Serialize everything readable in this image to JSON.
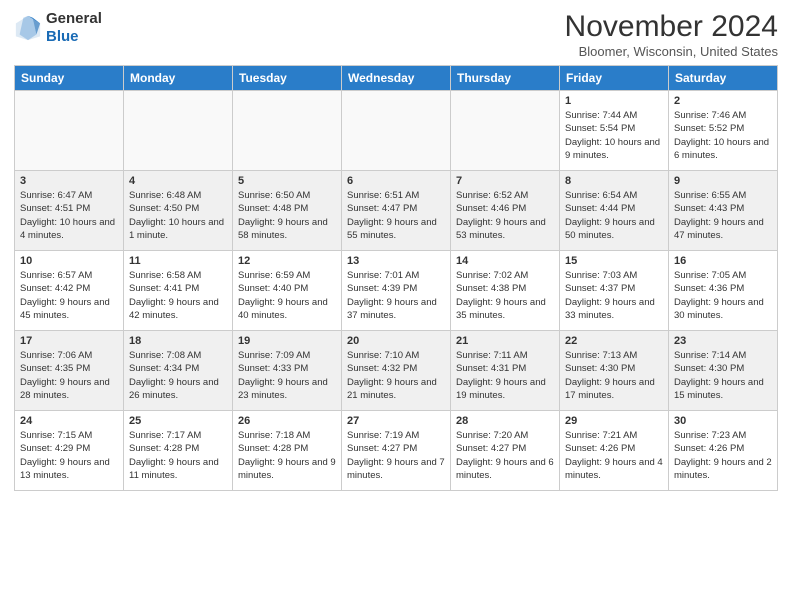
{
  "header": {
    "logo_line1": "General",
    "logo_line2": "Blue",
    "month": "November 2024",
    "location": "Bloomer, Wisconsin, United States"
  },
  "days_of_week": [
    "Sunday",
    "Monday",
    "Tuesday",
    "Wednesday",
    "Thursday",
    "Friday",
    "Saturday"
  ],
  "weeks": [
    [
      {
        "day": "",
        "info": ""
      },
      {
        "day": "",
        "info": ""
      },
      {
        "day": "",
        "info": ""
      },
      {
        "day": "",
        "info": ""
      },
      {
        "day": "",
        "info": ""
      },
      {
        "day": "1",
        "info": "Sunrise: 7:44 AM\nSunset: 5:54 PM\nDaylight: 10 hours and 9 minutes."
      },
      {
        "day": "2",
        "info": "Sunrise: 7:46 AM\nSunset: 5:52 PM\nDaylight: 10 hours and 6 minutes."
      }
    ],
    [
      {
        "day": "3",
        "info": "Sunrise: 6:47 AM\nSunset: 4:51 PM\nDaylight: 10 hours and 4 minutes."
      },
      {
        "day": "4",
        "info": "Sunrise: 6:48 AM\nSunset: 4:50 PM\nDaylight: 10 hours and 1 minute."
      },
      {
        "day": "5",
        "info": "Sunrise: 6:50 AM\nSunset: 4:48 PM\nDaylight: 9 hours and 58 minutes."
      },
      {
        "day": "6",
        "info": "Sunrise: 6:51 AM\nSunset: 4:47 PM\nDaylight: 9 hours and 55 minutes."
      },
      {
        "day": "7",
        "info": "Sunrise: 6:52 AM\nSunset: 4:46 PM\nDaylight: 9 hours and 53 minutes."
      },
      {
        "day": "8",
        "info": "Sunrise: 6:54 AM\nSunset: 4:44 PM\nDaylight: 9 hours and 50 minutes."
      },
      {
        "day": "9",
        "info": "Sunrise: 6:55 AM\nSunset: 4:43 PM\nDaylight: 9 hours and 47 minutes."
      }
    ],
    [
      {
        "day": "10",
        "info": "Sunrise: 6:57 AM\nSunset: 4:42 PM\nDaylight: 9 hours and 45 minutes."
      },
      {
        "day": "11",
        "info": "Sunrise: 6:58 AM\nSunset: 4:41 PM\nDaylight: 9 hours and 42 minutes."
      },
      {
        "day": "12",
        "info": "Sunrise: 6:59 AM\nSunset: 4:40 PM\nDaylight: 9 hours and 40 minutes."
      },
      {
        "day": "13",
        "info": "Sunrise: 7:01 AM\nSunset: 4:39 PM\nDaylight: 9 hours and 37 minutes."
      },
      {
        "day": "14",
        "info": "Sunrise: 7:02 AM\nSunset: 4:38 PM\nDaylight: 9 hours and 35 minutes."
      },
      {
        "day": "15",
        "info": "Sunrise: 7:03 AM\nSunset: 4:37 PM\nDaylight: 9 hours and 33 minutes."
      },
      {
        "day": "16",
        "info": "Sunrise: 7:05 AM\nSunset: 4:36 PM\nDaylight: 9 hours and 30 minutes."
      }
    ],
    [
      {
        "day": "17",
        "info": "Sunrise: 7:06 AM\nSunset: 4:35 PM\nDaylight: 9 hours and 28 minutes."
      },
      {
        "day": "18",
        "info": "Sunrise: 7:08 AM\nSunset: 4:34 PM\nDaylight: 9 hours and 26 minutes."
      },
      {
        "day": "19",
        "info": "Sunrise: 7:09 AM\nSunset: 4:33 PM\nDaylight: 9 hours and 23 minutes."
      },
      {
        "day": "20",
        "info": "Sunrise: 7:10 AM\nSunset: 4:32 PM\nDaylight: 9 hours and 21 minutes."
      },
      {
        "day": "21",
        "info": "Sunrise: 7:11 AM\nSunset: 4:31 PM\nDaylight: 9 hours and 19 minutes."
      },
      {
        "day": "22",
        "info": "Sunrise: 7:13 AM\nSunset: 4:30 PM\nDaylight: 9 hours and 17 minutes."
      },
      {
        "day": "23",
        "info": "Sunrise: 7:14 AM\nSunset: 4:30 PM\nDaylight: 9 hours and 15 minutes."
      }
    ],
    [
      {
        "day": "24",
        "info": "Sunrise: 7:15 AM\nSunset: 4:29 PM\nDaylight: 9 hours and 13 minutes."
      },
      {
        "day": "25",
        "info": "Sunrise: 7:17 AM\nSunset: 4:28 PM\nDaylight: 9 hours and 11 minutes."
      },
      {
        "day": "26",
        "info": "Sunrise: 7:18 AM\nSunset: 4:28 PM\nDaylight: 9 hours and 9 minutes."
      },
      {
        "day": "27",
        "info": "Sunrise: 7:19 AM\nSunset: 4:27 PM\nDaylight: 9 hours and 7 minutes."
      },
      {
        "day": "28",
        "info": "Sunrise: 7:20 AM\nSunset: 4:27 PM\nDaylight: 9 hours and 6 minutes."
      },
      {
        "day": "29",
        "info": "Sunrise: 7:21 AM\nSunset: 4:26 PM\nDaylight: 9 hours and 4 minutes."
      },
      {
        "day": "30",
        "info": "Sunrise: 7:23 AM\nSunset: 4:26 PM\nDaylight: 9 hours and 2 minutes."
      }
    ]
  ]
}
